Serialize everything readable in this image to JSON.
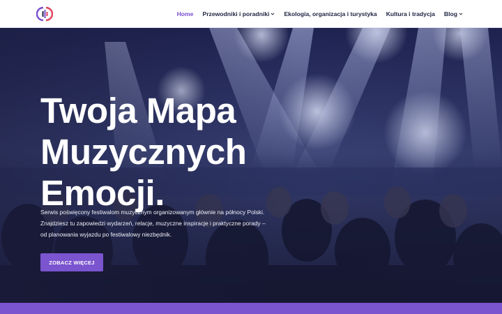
{
  "brand": {
    "logo_icon": "music-map-logo-icon",
    "accent": "#7b54cf"
  },
  "nav": {
    "items": [
      {
        "label": "Home",
        "active": true,
        "dropdown": false
      },
      {
        "label": "Przewodniki i poradniki",
        "active": false,
        "dropdown": true
      },
      {
        "label": "Ekologia, organizacja i turystyka",
        "active": false,
        "dropdown": false
      },
      {
        "label": "Kultura i tradycja",
        "active": false,
        "dropdown": false
      },
      {
        "label": "Blog",
        "active": false,
        "dropdown": true
      }
    ]
  },
  "hero": {
    "title_line1": "Twoja Mapa",
    "title_line2": "Muzycznych",
    "title_line3": "Emocji.",
    "description": "Serwis poświęcony festiwalom muzycznym organizowanym głównie na północy Polski. Znajdziesz tu zapowiedzi wydarzeń, relacje, muzyczne inspiracje i praktyczne porady – od planowania wyjazdu po festiwalowy niezbędnik.",
    "cta_label": "ZOBACZ WIĘCEJ"
  }
}
